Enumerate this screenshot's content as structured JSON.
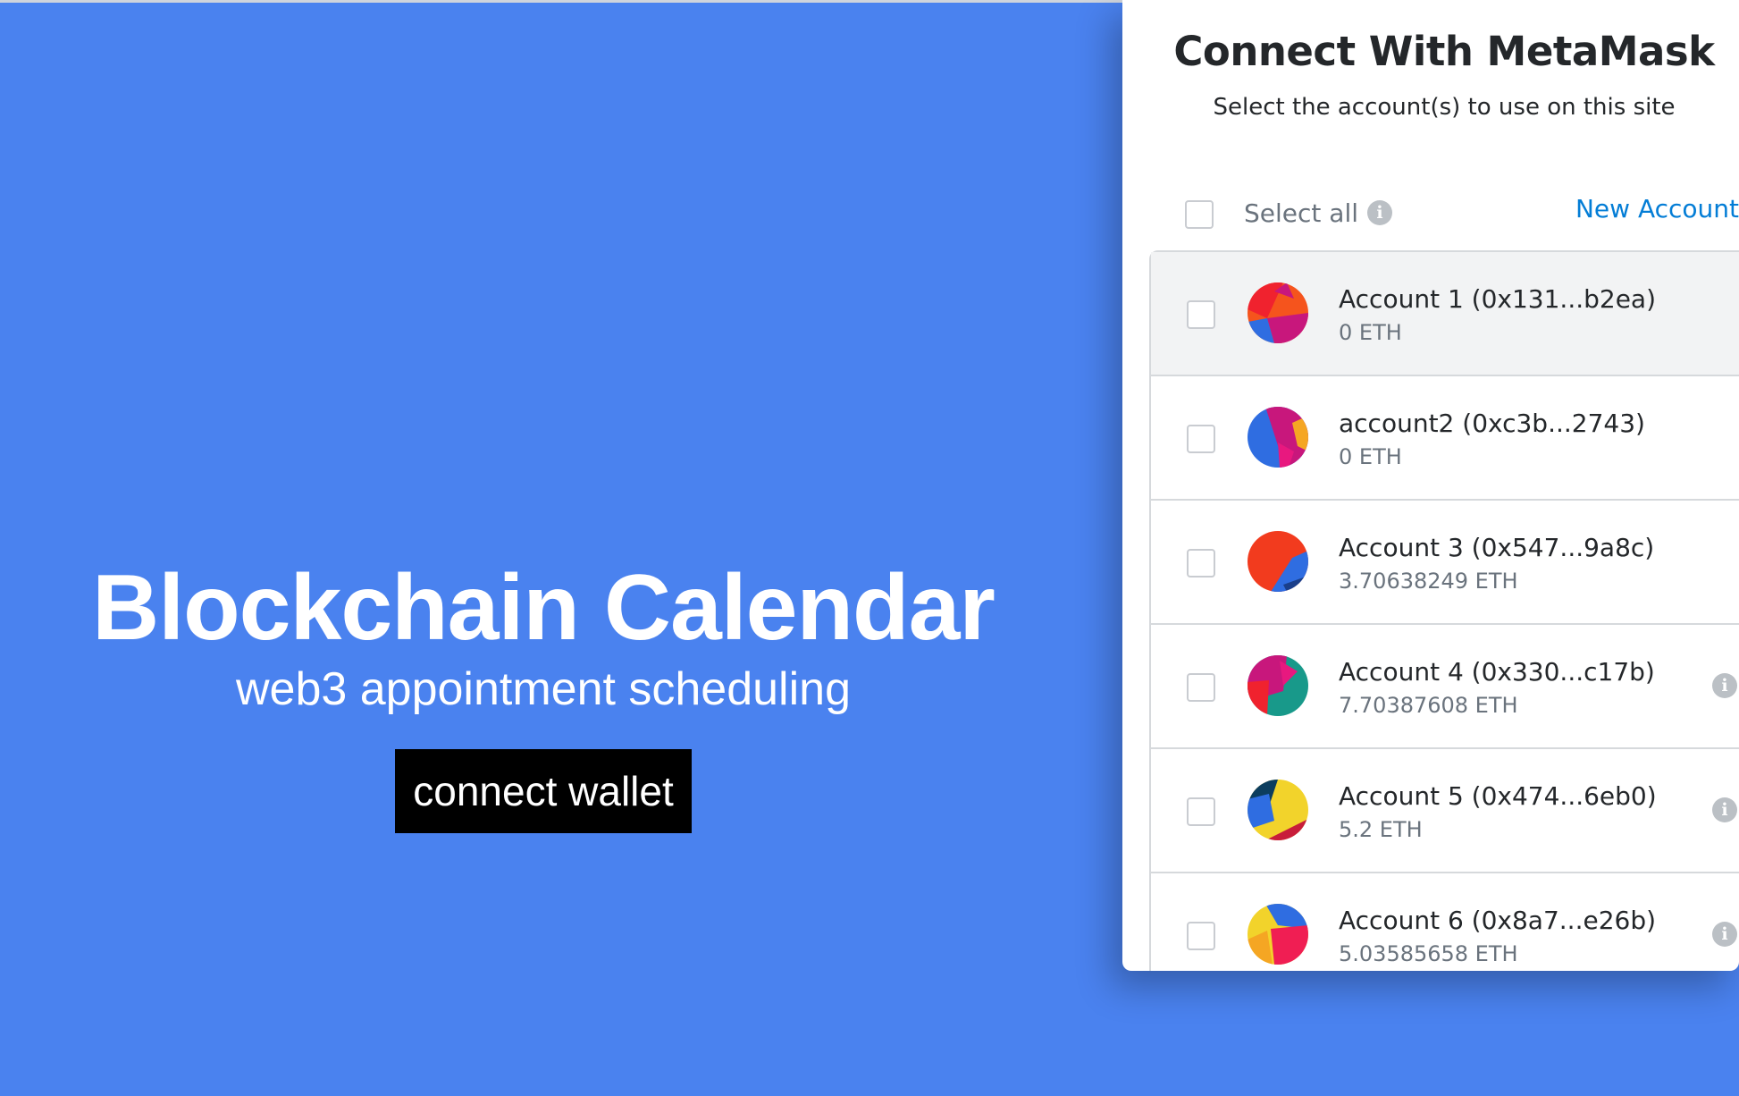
{
  "app": {
    "title": "Blockchain Calendar",
    "subtitle": "web3 appointment scheduling",
    "connect_label": "connect wallet",
    "background_color": "#4a82ef"
  },
  "metamask": {
    "title": "Connect With MetaMask",
    "subtitle": "Select the account(s) to use on this site",
    "select_all_label": "Select all",
    "new_account_label": "New Account",
    "info_icon": "i",
    "accent_color": "#037dd6",
    "accounts": [
      {
        "label": "Account 1 (0x131...b2ea)",
        "balance": "0 ETH",
        "active": true,
        "has_info": false
      },
      {
        "label": "account2 (0xc3b...2743)",
        "balance": "0 ETH",
        "active": false,
        "has_info": false
      },
      {
        "label": "Account 3 (0x547...9a8c)",
        "balance": "3.70638249 ETH",
        "active": false,
        "has_info": false
      },
      {
        "label": "Account 4 (0x330...c17b)",
        "balance": "7.70387608 ETH",
        "active": false,
        "has_info": true
      },
      {
        "label": "Account 5 (0x474...6eb0)",
        "balance": "5.2 ETH",
        "active": false,
        "has_info": true
      },
      {
        "label": "Account 6 (0x8a7...e26b)",
        "balance": "5.03585658 ETH",
        "active": false,
        "has_info": true
      }
    ]
  }
}
